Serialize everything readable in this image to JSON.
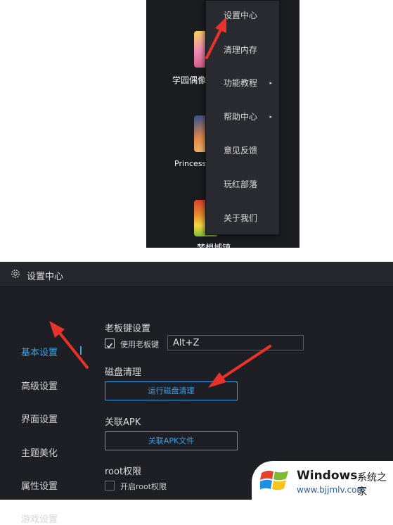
{
  "launcher": {
    "apps": [
      {
        "label": "学园偶像"
      },
      {
        "label": "PrincessC"
      },
      {
        "label": "梦想城镇"
      }
    ],
    "menu": [
      {
        "label": "设置中心",
        "submenu": false
      },
      {
        "label": "清理内存",
        "submenu": false
      },
      {
        "label": "功能教程",
        "submenu": true
      },
      {
        "label": "帮助中心",
        "submenu": true
      },
      {
        "label": "意见反馈",
        "submenu": false
      },
      {
        "label": "玩红部落",
        "submenu": false
      },
      {
        "label": "关于我们",
        "submenu": false
      }
    ],
    "submenu_glyph": "▸"
  },
  "settings": {
    "title": "设置中心",
    "icon": "gear-icon",
    "sidebar": [
      {
        "label": "基本设置",
        "active": true
      },
      {
        "label": "高级设置",
        "active": false
      },
      {
        "label": "界面设置",
        "active": false
      },
      {
        "label": "主题美化",
        "active": false
      },
      {
        "label": "属性设置",
        "active": false
      },
      {
        "label": "游戏设置",
        "active": false
      }
    ],
    "boss_key": {
      "title": "老板键设置",
      "checkbox_label": "使用老板键",
      "checked": true,
      "value": "Alt+Z"
    },
    "disk": {
      "title": "磁盘清理",
      "button": "运行磁盘清理"
    },
    "apk": {
      "title": "关联APK",
      "help": "?",
      "button": "关联APK文件"
    },
    "root": {
      "title": "root权限",
      "checkbox_label": "开启root权限",
      "checked": false
    }
  },
  "watermark": {
    "brand": "Windows",
    "cn": "系统之家",
    "url": "www.bjjmlv.com"
  },
  "colors": {
    "accent": "#3aa0e6",
    "annotation": "#e8332a",
    "window_bg": "#1e1f24"
  }
}
